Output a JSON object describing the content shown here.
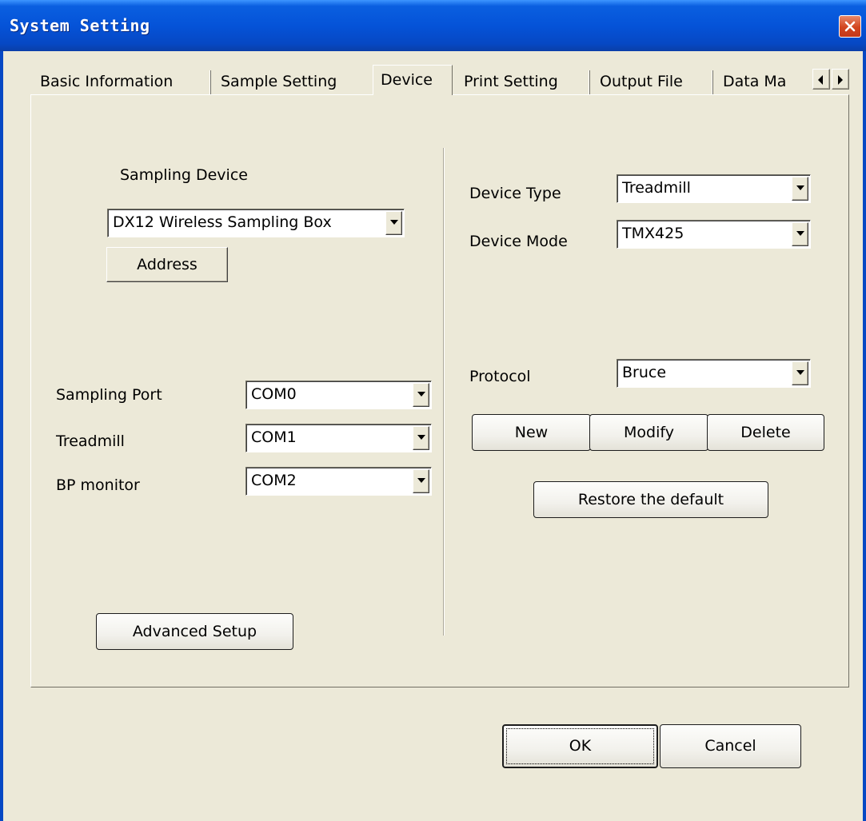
{
  "window": {
    "title": "System Setting"
  },
  "tabs": [
    {
      "label": "Basic Information"
    },
    {
      "label": "Sample Setting"
    },
    {
      "label": "Device",
      "active": true
    },
    {
      "label": "Print Setting"
    },
    {
      "label": "Output File"
    },
    {
      "label": "Data Ma"
    }
  ],
  "left": {
    "sampling_device_label": "Sampling Device",
    "sampling_device_value": "DX12 Wireless Sampling Box",
    "address_button": "Address",
    "sampling_port_label": "Sampling Port",
    "sampling_port_value": "COM0",
    "treadmill_label": "Treadmill",
    "treadmill_value": "COM1",
    "bp_monitor_label": "BP monitor",
    "bp_monitor_value": "COM2",
    "advanced_button": "Advanced Setup"
  },
  "right": {
    "device_type_label": "Device Type",
    "device_type_value": "Treadmill",
    "device_mode_label": "Device Mode",
    "device_mode_value": "TMX425",
    "protocol_label": "Protocol",
    "protocol_value": "Bruce",
    "new_button": "New",
    "modify_button": "Modify",
    "delete_button": "Delete",
    "restore_button": "Restore the default"
  },
  "footer": {
    "ok_button": "OK",
    "cancel_button": "Cancel"
  },
  "icons": {
    "close": "close-icon",
    "tab_scroll_left": "triangle-left-icon",
    "tab_scroll_right": "triangle-right-icon",
    "dropdown": "triangle-down-icon"
  },
  "colors": {
    "titlebar": "#0553d8",
    "dialog_bg": "#ece9d8",
    "close_button": "#d2451e"
  }
}
